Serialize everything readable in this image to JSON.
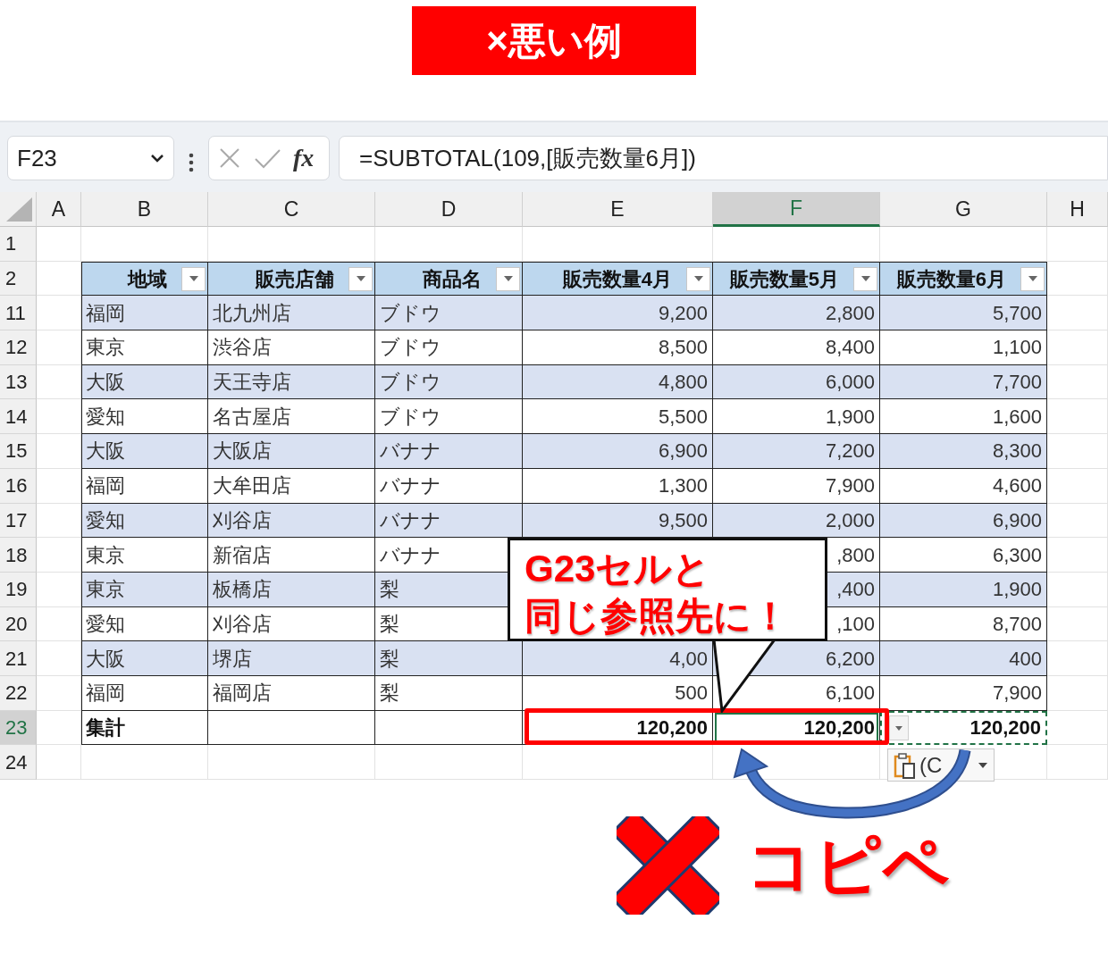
{
  "banner": {
    "text": "×悪い例"
  },
  "name_box": {
    "value": "F23"
  },
  "formula_bar": {
    "fx": "fx",
    "value": "=SUBTOTAL(109,[販売数量6月])"
  },
  "columns": [
    {
      "label": "A",
      "selected": false
    },
    {
      "label": "B",
      "selected": false
    },
    {
      "label": "C",
      "selected": false
    },
    {
      "label": "D",
      "selected": false
    },
    {
      "label": "E",
      "selected": false
    },
    {
      "label": "F",
      "selected": true
    },
    {
      "label": "G",
      "selected": false
    },
    {
      "label": "H",
      "selected": false
    }
  ],
  "rows": [
    {
      "number": "1",
      "kind": "blank",
      "selected": false,
      "cells": {}
    },
    {
      "number": "2",
      "kind": "header",
      "selected": false,
      "cells": {
        "B": "地域",
        "C": "販売店舗",
        "D": "商品名",
        "E": "販売数量4月",
        "F": "販売数量5月",
        "G": "販売数量6月"
      }
    },
    {
      "number": "11",
      "kind": "data",
      "banded": true,
      "selected": false,
      "cells": {
        "B": "福岡",
        "C": "北九州店",
        "D": "ブドウ",
        "E": "9,200",
        "F": "2,800",
        "G": "5,700"
      }
    },
    {
      "number": "12",
      "kind": "data",
      "banded": false,
      "selected": false,
      "cells": {
        "B": "東京",
        "C": "渋谷店",
        "D": "ブドウ",
        "E": "8,500",
        "F": "8,400",
        "G": "1,100"
      }
    },
    {
      "number": "13",
      "kind": "data",
      "banded": true,
      "selected": false,
      "cells": {
        "B": "大阪",
        "C": "天王寺店",
        "D": "ブドウ",
        "E": "4,800",
        "F": "6,000",
        "G": "7,700"
      }
    },
    {
      "number": "14",
      "kind": "data",
      "banded": false,
      "selected": false,
      "cells": {
        "B": "愛知",
        "C": "名古屋店",
        "D": "ブドウ",
        "E": "5,500",
        "F": "1,900",
        "G": "1,600"
      }
    },
    {
      "number": "15",
      "kind": "data",
      "banded": true,
      "selected": false,
      "cells": {
        "B": "大阪",
        "C": "大阪店",
        "D": "バナナ",
        "E": "6,900",
        "F": "7,200",
        "G": "8,300"
      }
    },
    {
      "number": "16",
      "kind": "data",
      "banded": false,
      "selected": false,
      "cells": {
        "B": "福岡",
        "C": "大牟田店",
        "D": "バナナ",
        "E": "1,300",
        "F": "7,900",
        "G": "4,600"
      }
    },
    {
      "number": "17",
      "kind": "data",
      "banded": true,
      "selected": false,
      "cells": {
        "B": "愛知",
        "C": "刈谷店",
        "D": "バナナ",
        "E": "9,500",
        "F": "2,000",
        "G": "6,900"
      }
    },
    {
      "number": "18",
      "kind": "data",
      "banded": false,
      "selected": false,
      "cells": {
        "B": "東京",
        "C": "新宿店",
        "D": "バナナ",
        "F": ",800",
        "G": "6,300"
      }
    },
    {
      "number": "19",
      "kind": "data",
      "banded": true,
      "selected": false,
      "cells": {
        "B": "東京",
        "C": "板橋店",
        "D": "梨",
        "F": ",400",
        "G": "1,900"
      }
    },
    {
      "number": "20",
      "kind": "data",
      "banded": false,
      "selected": false,
      "cells": {
        "B": "愛知",
        "C": "刈谷店",
        "D": "梨",
        "F": ",100",
        "G": "8,700"
      }
    },
    {
      "number": "21",
      "kind": "data",
      "banded": true,
      "selected": false,
      "cells": {
        "B": "大阪",
        "C": "堺店",
        "D": "梨",
        "E": "4,00",
        "F": "6,200",
        "G": "400"
      }
    },
    {
      "number": "22",
      "kind": "data",
      "banded": false,
      "selected": false,
      "cells": {
        "B": "福岡",
        "C": "福岡店",
        "D": "梨",
        "E": "500",
        "F": "6,100",
        "G": "7,900"
      }
    },
    {
      "number": "23",
      "kind": "total",
      "selected": true,
      "cells": {
        "B": {
          "text": "集計",
          "active": false,
          "copied": false
        },
        "E": {
          "text": "120,200",
          "active": false,
          "copied": false
        },
        "F": {
          "text": "120,200",
          "active": true,
          "copied": false
        },
        "G": {
          "text": "120,200",
          "active": false,
          "copied": true
        }
      }
    },
    {
      "number": "24",
      "kind": "blank",
      "selected": false,
      "cells": {}
    }
  ],
  "paste_options": {
    "label": "(C"
  },
  "callout": {
    "lines": [
      "G23セルと",
      "同じ参照先に！"
    ]
  },
  "caption": {
    "text": "コピペ"
  }
}
